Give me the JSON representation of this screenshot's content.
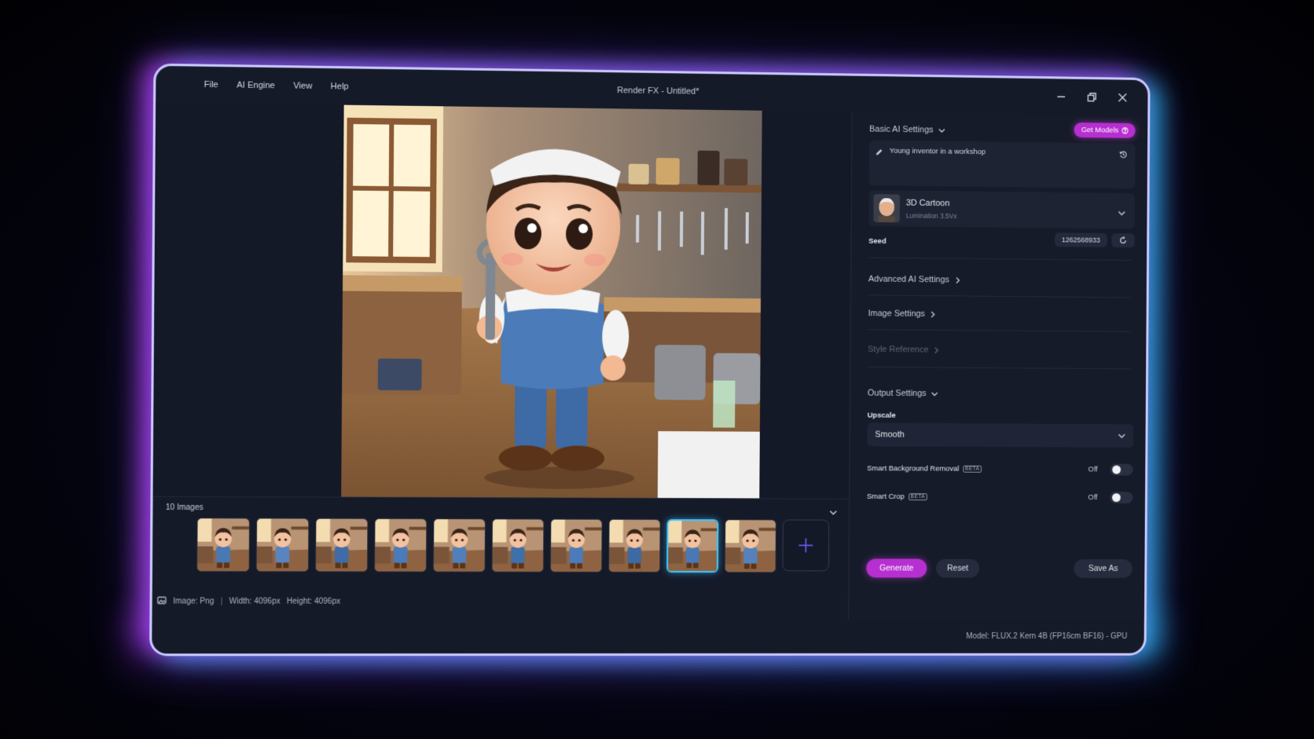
{
  "window": {
    "title": "Render FX - Untitled*",
    "menu": [
      "File",
      "AI Engine",
      "View",
      "Help"
    ]
  },
  "gallery": {
    "count_label": "10 Images",
    "thumbnail_count": 10,
    "selected_index": 8
  },
  "status": {
    "image": "Image: Png",
    "width": "Width: 4096px",
    "height": "Height: 4096px"
  },
  "panel": {
    "basic_ai_settings": "Basic AI Settings",
    "get_models": "Get Models",
    "prompt": "Young inventor in a workshop",
    "model_name": "3D Cartoon",
    "model_sub": "Lumination 3.5Vx",
    "seed_label": "Seed",
    "seed_value": "1262568933",
    "advanced_ai_settings": "Advanced AI Settings",
    "image_settings": "Image Settings",
    "style_reference": "Style Reference",
    "output_settings": "Output Settings",
    "upscale_label": "Upscale",
    "upscale_value": "Smooth",
    "smart_bg_removal": "Smart Background Removal",
    "smart_bg_state": "Off",
    "smart_crop": "Smart Crop",
    "smart_crop_state": "Off",
    "beta": "BETA",
    "generate": "Generate",
    "reset": "Reset",
    "save_as": "Save As"
  },
  "footer": {
    "model_info": "Model: FLUX.2 Kern 4B (FP16cm BF16) - GPU"
  },
  "colors": {
    "accent": "#b62fd0",
    "glow_left": "#be3cff",
    "glow_right": "#28c8ff",
    "panel_bg": "#161b29"
  }
}
